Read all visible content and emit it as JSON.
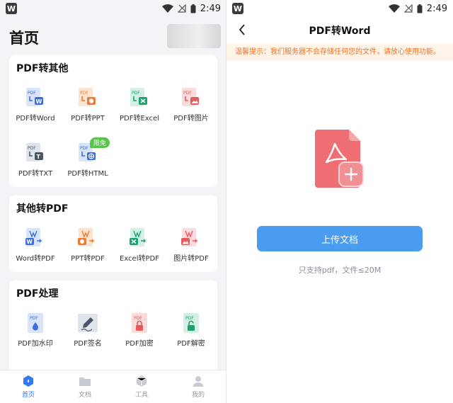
{
  "status_bar": {
    "logo": "W",
    "time": "2:49",
    "icons": [
      "wifi-icon",
      "signal-off-icon",
      "battery-icon"
    ]
  },
  "home": {
    "title": "首页",
    "sections": [
      {
        "title": "PDF转其他",
        "tools": [
          {
            "label": "PDF转Word",
            "icon": "pdf-to-word-icon",
            "color": "#3b6fe0"
          },
          {
            "label": "PDF转PPT",
            "icon": "pdf-to-ppt-icon",
            "color": "#f07a2e"
          },
          {
            "label": "PDF转Excel",
            "icon": "pdf-to-excel-icon",
            "color": "#1aa36f"
          },
          {
            "label": "PDF转图片",
            "icon": "pdf-to-image-icon",
            "color": "#e85a5a"
          },
          {
            "label": "PDF转TXT",
            "icon": "pdf-to-txt-icon",
            "color": "#4a5568"
          },
          {
            "label": "PDF转HTML",
            "icon": "pdf-to-html-icon",
            "color": "#3b6fe0",
            "badge": "限免"
          }
        ]
      },
      {
        "title": "其他转PDF",
        "tools": [
          {
            "label": "Word转PDF",
            "icon": "word-to-pdf-icon",
            "color": "#3b6fe0"
          },
          {
            "label": "PPT转PDF",
            "icon": "ppt-to-pdf-icon",
            "color": "#f07a2e"
          },
          {
            "label": "Excel转PDF",
            "icon": "excel-to-pdf-icon",
            "color": "#1aa36f"
          },
          {
            "label": "图片转PDF",
            "icon": "image-to-pdf-icon",
            "color": "#e85a5a"
          }
        ]
      },
      {
        "title": "PDF处理",
        "tools": [
          {
            "label": "PDF加水印",
            "icon": "watermark-icon",
            "color": "#3b6fe0"
          },
          {
            "label": "PDF签名",
            "icon": "signature-icon",
            "color": "#4a5568"
          },
          {
            "label": "PDF加密",
            "icon": "encrypt-icon",
            "color": "#e85a5a"
          },
          {
            "label": "PDF解密",
            "icon": "decrypt-icon",
            "color": "#1aa36f"
          }
        ]
      }
    ],
    "tabs": [
      {
        "label": "首页",
        "icon": "home-icon",
        "active": true
      },
      {
        "label": "文档",
        "icon": "folder-icon",
        "active": false
      },
      {
        "label": "工具",
        "icon": "toolbox-icon",
        "active": false
      },
      {
        "label": "我的",
        "icon": "profile-icon",
        "active": false
      }
    ]
  },
  "convert": {
    "title": "PDF转Word",
    "notice": "温馨提示：我们服务器不会存储任何您的文件，请放心使用功能。",
    "upload_label": "上传文档",
    "hint": "只支持pdf，文件≤20M",
    "accent": "#4a9cf0",
    "hero_icon": "pdf-add-icon"
  }
}
